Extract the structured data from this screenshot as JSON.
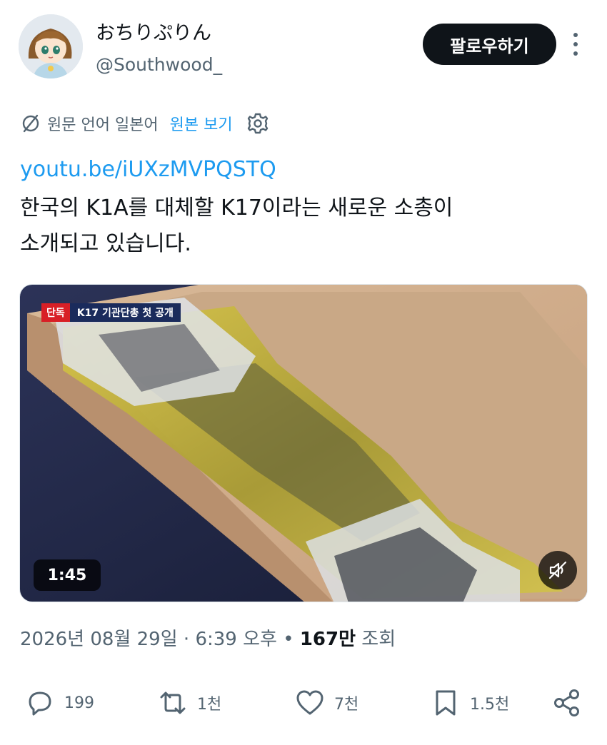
{
  "user": {
    "display_name": "おちりぷりん",
    "handle": "@Southwood_",
    "avatar_icon": "avatar-character"
  },
  "header": {
    "follow_label": "팔로우하기",
    "more_icon": "more-vertical-icon"
  },
  "translation": {
    "icon": "translate-off-icon",
    "source_text": "원문 언어 일본어",
    "show_original_label": "원본 보기",
    "settings_icon": "gear-icon"
  },
  "tweet": {
    "link": "youtu.be/iUXzMVPQSTQ",
    "line1": "한국의 K1A를 대체할 K17이라는 새로운 소총이",
    "line2": "소개되고 있습니다."
  },
  "media": {
    "badge_exclusive": "단독",
    "badge_title": "K17 기관단총 첫 공개",
    "duration": "1:45",
    "mute_icon": "muted-speaker-icon"
  },
  "meta": {
    "date": "2026년 08월 29일",
    "sep1": " · ",
    "time": "6:39 오후",
    "sep2": " • ",
    "views_count": "167만",
    "views_label": "조회"
  },
  "actions": {
    "reply_count": "199",
    "retweet_count": "1천",
    "like_count": "7천",
    "bookmark_count": "1.5천"
  },
  "colors": {
    "accent": "#1d9bf0",
    "text_primary": "#0f1419",
    "text_secondary": "#536471",
    "button_dark": "#0f1419"
  }
}
